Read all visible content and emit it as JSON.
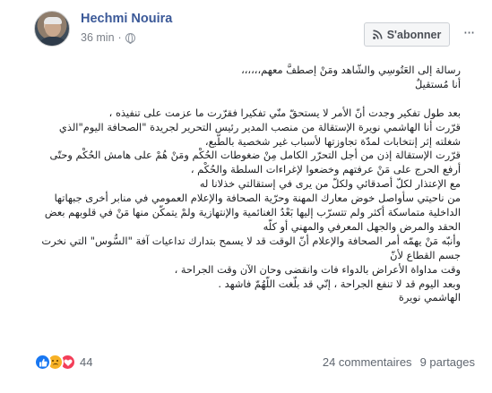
{
  "post": {
    "author": "Hechmi Nouira",
    "time": "36 min",
    "time_separator": "·",
    "privacy_icon": "globe-icon",
    "follow_label": "S'abonner",
    "follow_icon": "rss-icon",
    "more_label": "···",
    "body": [
      "رسالة إلى العَتُوسِي والشّاهد ومَنْ إصطفَّ معهم،،،،،،",
      "أنا مُستقيلٌ",
      "",
      "بعد طول تفكير وجدت أنّ الأمر لا يستحقّ منّي تفكيرا فقرّرت ما عزمت على تنفيذه ،",
      "قرّرت أنا الهاشمي نويرة الإستقالة من منصب المدير رئيس التحرير لجريدة \"الصحافة اليوم\"الذي شغلته إثر إنتخابات لمدّة تجاوزتها لأسباب غير شخصية بالطّبع،",
      "قرّرت الإستقالة إذن من أجل التحرّر الكامل مِنْ ضغوطات الحُكْم ومَنْ هُمْ على هامش الحُكْم وحتّى أرفع الحرج على مَنْ عرفتهم وخضعوا لإغراءات السلطة والحُكْم ،",
      "مع الإعتذار لكلّ أصدقائي ولكلّ من يرى في إستقالتي خذلانا له",
      "من ناحيتي سأواصل خوض معارك المهنة وحرّية الصحافة والإعلام العمومي في منابر أخرى جبهاتها الداخلية متماسكة أكثر ولم تتسرّب إليها بَعْدُ الغنائمية والإنتهازية ولمْ يتمكّن منها مَنْ في قلوبهم بعض الحقد والمرض والجهل المعرفي والمهني أو كلّه",
      "وأنبّه مَنْ يهمّه أمر الصحافة والإعلام أنّ الوقت قد لا يسمح بتدارك تداعيات آفة \"السُّوس\" التي نخرت جسم القطاع لأنّ",
      "وقت مداواة الأعراض بالدواء فات وانقضى وحان الآن وقت الجراحة ،",
      "وبعد اليوم قد لا تنفع الجراحة ، إنّي قد بلّغت اللّهُمّ فاشهد .",
      "الهاشمي نويرة"
    ]
  },
  "footer": {
    "reactions": [
      "like-icon",
      "sad-icon",
      "love-icon"
    ],
    "reaction_count": "44",
    "comments": "24 commentaires",
    "shares": "9 partages"
  },
  "colors": {
    "author": "#3b5998",
    "meta": "#7a7f87",
    "like": "#1877f2",
    "sad": "#f7b125",
    "love": "#f33e58"
  }
}
